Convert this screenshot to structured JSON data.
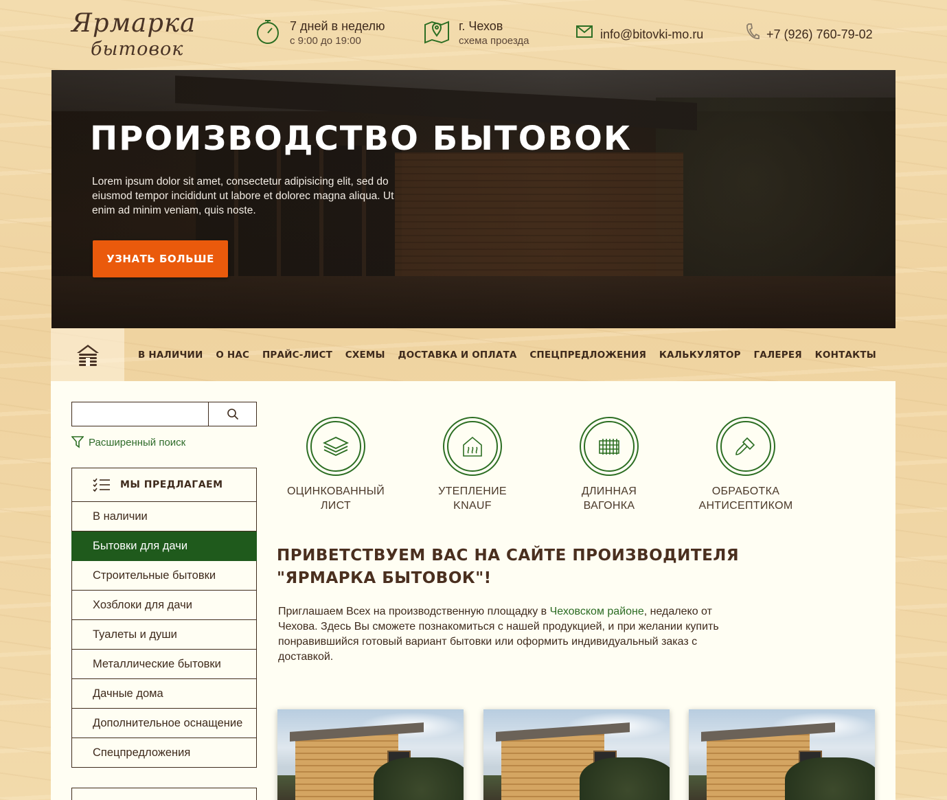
{
  "header": {
    "logo_line1": "Ярмарка",
    "logo_line2": "бытовок",
    "hours_title": "7 дней в неделю",
    "hours_sub": "с 9:00 до 19:00",
    "city_title": "г. Чехов",
    "city_sub": "схема проезда",
    "email": "info@bitovki-mo.ru",
    "phone": "+7 (926) 760-79-02"
  },
  "hero": {
    "title": "ПРОИЗВОДСТВО БЫТОВОК",
    "text": "Lorem ipsum dolor sit amet, consectetur adipisicing elit, sed do eiusmod tempor incididunt ut labore et dolorec magna aliqua. Ut enim ad minim veniam, quis noste.",
    "button": "УЗНАТЬ БОЛЬШЕ"
  },
  "nav": {
    "items": [
      "В НАЛИЧИИ",
      "О НАС",
      "ПРАЙС-ЛИСТ",
      "СХЕМЫ",
      "ДОСТАВКА И ОПЛАТА",
      "СПЕЦПРЕДЛОЖЕНИЯ",
      "КАЛЬКУЛЯТОР",
      "ГАЛЕРЕЯ",
      "КОНТАКТЫ"
    ]
  },
  "search": {
    "value": "",
    "advanced": "Расширенный поиск"
  },
  "menu": {
    "title": "МЫ ПРЕДЛАГАЕМ",
    "items": [
      "В наличии",
      "Бытовки для дачи",
      "Строительные бытовки",
      "Хозблоки для дачи",
      "Туалеты и души",
      "Металлические бытовки",
      "Дачные дома",
      "Дополнительное оснащение",
      "Спецпредложения"
    ],
    "active_index": 1
  },
  "features": [
    {
      "line1": "ОЦИНКОВАННЫЙ",
      "line2": "ЛИСТ",
      "icon": "layers-icon"
    },
    {
      "line1": "УТЕПЛЕНИЕ",
      "line2": "KNAUF",
      "icon": "heated-house-icon"
    },
    {
      "line1": "ДЛИННАЯ",
      "line2": "ВАГОНКА",
      "icon": "wood-panel-icon"
    },
    {
      "line1": "ОБРАБОТКА",
      "line2": "АНТИСЕПТИКОМ",
      "icon": "brush-icon"
    }
  ],
  "welcome": {
    "title": "ПРИВЕТСТВУЕМ ВАС НА САЙТЕ ПРОИЗВОДИТЕЛЯ \"ЯРМАРКА БЫТОВОК\"!",
    "text_before": "Приглашаем Всех на производственную площадку в ",
    "link": "Чеховском районе",
    "text_after": ", недалеко от Чехова. Здесь Вы сможете познакомиться с нашей продукцией, и при желании купить понравившийся готовый вариант бытовки или оформить индивидуальный заказ с доставкой."
  },
  "colors": {
    "accent_green": "#2c6e23",
    "active_green": "#1f5a1c",
    "button_orange": "#ea5a0c",
    "text_brown": "#3e2a1c"
  }
}
